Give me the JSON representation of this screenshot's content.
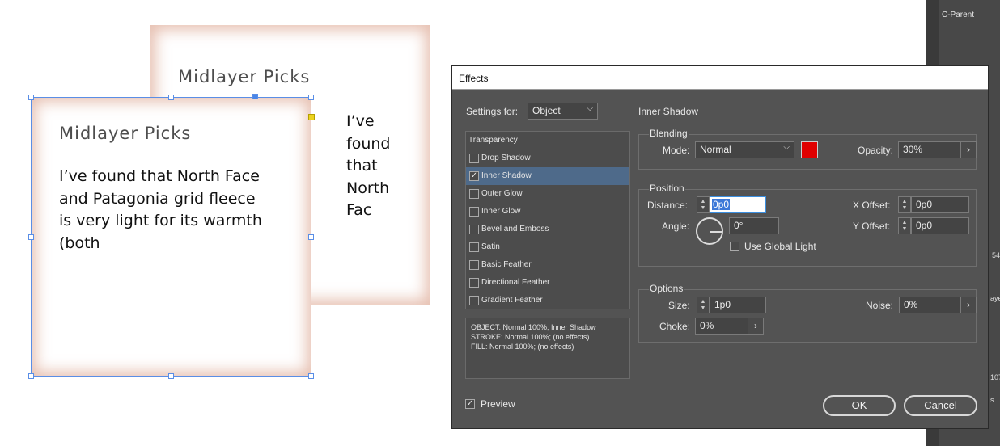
{
  "canvas": {
    "back_frame": {
      "title": "Midlayer Picks"
    },
    "front_frame": {
      "title": "Midlayer Picks",
      "body": "I’ve found that North Face\nand Patagonia grid fleece\nis very light for its warmth\n(both"
    },
    "overflow_text": "I’ve\nfound\nthat\nNorth\nFac"
  },
  "right_panel": {
    "tab_label": "C-Parent",
    "edge_labels": [
      "54",
      "aye",
      "107",
      "s"
    ]
  },
  "dialog": {
    "title": "Effects",
    "settings_for": {
      "label": "Settings for:",
      "value": "Object"
    },
    "section_title": "Inner Shadow",
    "list_header": "Transparency",
    "effects": [
      {
        "label": "Drop Shadow",
        "checked": false,
        "selected": false
      },
      {
        "label": "Inner Shadow",
        "checked": true,
        "selected": true
      },
      {
        "label": "Outer Glow",
        "checked": false,
        "selected": false
      },
      {
        "label": "Inner Glow",
        "checked": false,
        "selected": false
      },
      {
        "label": "Bevel and Emboss",
        "checked": false,
        "selected": false
      },
      {
        "label": "Satin",
        "checked": false,
        "selected": false
      },
      {
        "label": "Basic Feather",
        "checked": false,
        "selected": false
      },
      {
        "label": "Directional Feather",
        "checked": false,
        "selected": false
      },
      {
        "label": "Gradient Feather",
        "checked": false,
        "selected": false
      }
    ],
    "summary": [
      "OBJECT: Normal 100%; Inner Shadow",
      "STROKE: Normal 100%; (no effects)",
      "FILL: Normal 100%; (no effects)"
    ],
    "blending": {
      "legend": "Blending",
      "mode_label": "Mode:",
      "mode_value": "Normal",
      "swatch_color": "#e00000",
      "opacity_label": "Opacity:",
      "opacity_value": "30%"
    },
    "position": {
      "legend": "Position",
      "distance_label": "Distance:",
      "distance_value": "0p0",
      "angle_label": "Angle:",
      "angle_value": "0°",
      "global_light_label": "Use Global Light",
      "x_offset_label": "X Offset:",
      "x_offset_value": "0p0",
      "y_offset_label": "Y Offset:",
      "y_offset_value": "0p0"
    },
    "options": {
      "legend": "Options",
      "size_label": "Size:",
      "size_value": "1p0",
      "choke_label": "Choke:",
      "choke_value": "0%",
      "noise_label": "Noise:",
      "noise_value": "0%"
    },
    "preview_label": "Preview",
    "ok_label": "OK",
    "cancel_label": "Cancel"
  }
}
